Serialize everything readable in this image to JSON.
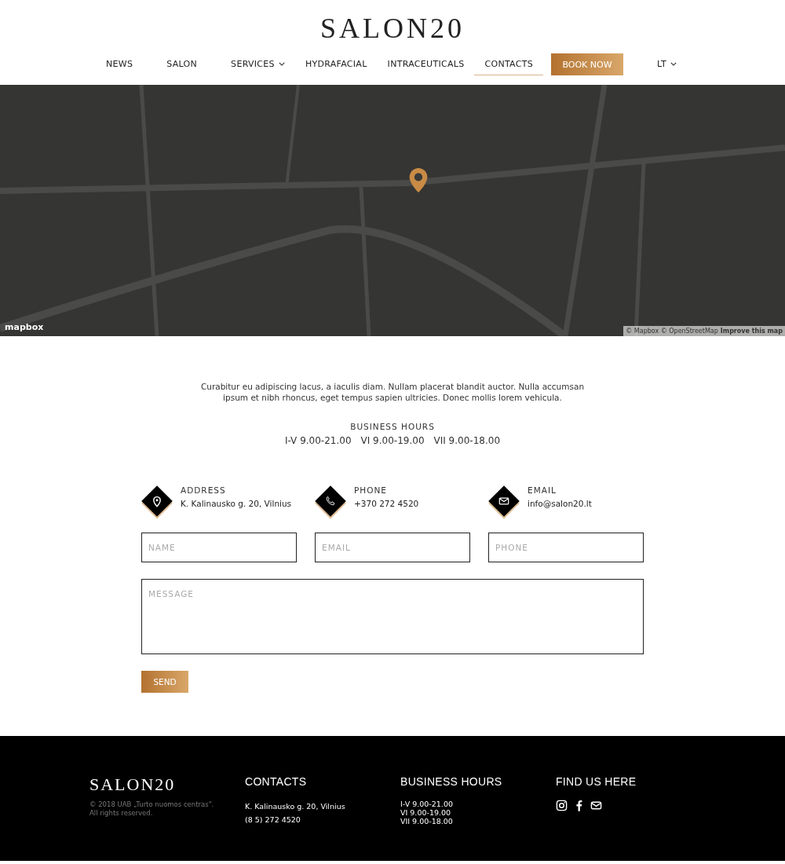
{
  "header": {
    "logo": "SALON20",
    "nav": [
      {
        "label": "NEWS",
        "selected": false,
        "dropdown": false
      },
      {
        "label": "SALON",
        "selected": false,
        "dropdown": false
      },
      {
        "label": "SERVICES",
        "selected": false,
        "dropdown": true
      },
      {
        "label": "HYDRAFACIAL",
        "selected": false,
        "dropdown": false
      },
      {
        "label": "INTRACEUTICALS",
        "selected": false,
        "dropdown": false
      },
      {
        "label": "CONTACTS",
        "selected": true,
        "dropdown": false
      }
    ],
    "cta": "BOOK NOW",
    "language": "LT"
  },
  "map": {
    "logo": "mapbox",
    "attribution": "© Mapbox © OpenStreetMap",
    "improve_link": "Improve this map"
  },
  "intro": "Curabitur eu adipiscing lacus, a iaculis diam. Nullam placerat blandit auctor. Nulla accumsan ipsum et nibh rhoncus, eget tempus sapien ultricies. Donec mollis lorem vehicula.",
  "business_hours": {
    "title": "BUSINESS HOURS",
    "entries": [
      "I-V 9.00-21.00",
      "VI 9.00-19.00",
      "VII 9.00-18.00"
    ]
  },
  "contacts": [
    {
      "kind": "address",
      "label": "ADDRESS",
      "value": "K. Kalinausko g. 20, Vilnius"
    },
    {
      "kind": "phone",
      "label": "PHONE",
      "value": "+370 272 4520"
    },
    {
      "kind": "email",
      "label": "EMAIL",
      "value": "info@salon20.lt"
    }
  ],
  "form": {
    "fields": [
      {
        "placeholder": "NAME"
      },
      {
        "placeholder": "EMAIL"
      },
      {
        "placeholder": "PHONE"
      }
    ],
    "message_placeholder": "MESSAGE",
    "submit": "SEND"
  },
  "footer": {
    "logo": "SALON20",
    "copyright": "© 2018 UAB „Turto nuomos centras\".",
    "rights": "All rights reserved.",
    "contacts": {
      "title": "CONTACTS",
      "lines": [
        "K. Kalinausko g. 20, Vilnius",
        "(8 5) 272 4520"
      ]
    },
    "hours": {
      "title": "BUSINESS HOURS",
      "lines": [
        "I-V 9.00-21.00",
        "VI 9.00-19.00",
        "VII 9.00-18.00"
      ]
    },
    "social": {
      "title": "FIND US HERE",
      "links": [
        {
          "kind": "instagram"
        },
        {
          "kind": "facebook"
        },
        {
          "kind": "email"
        }
      ]
    }
  }
}
